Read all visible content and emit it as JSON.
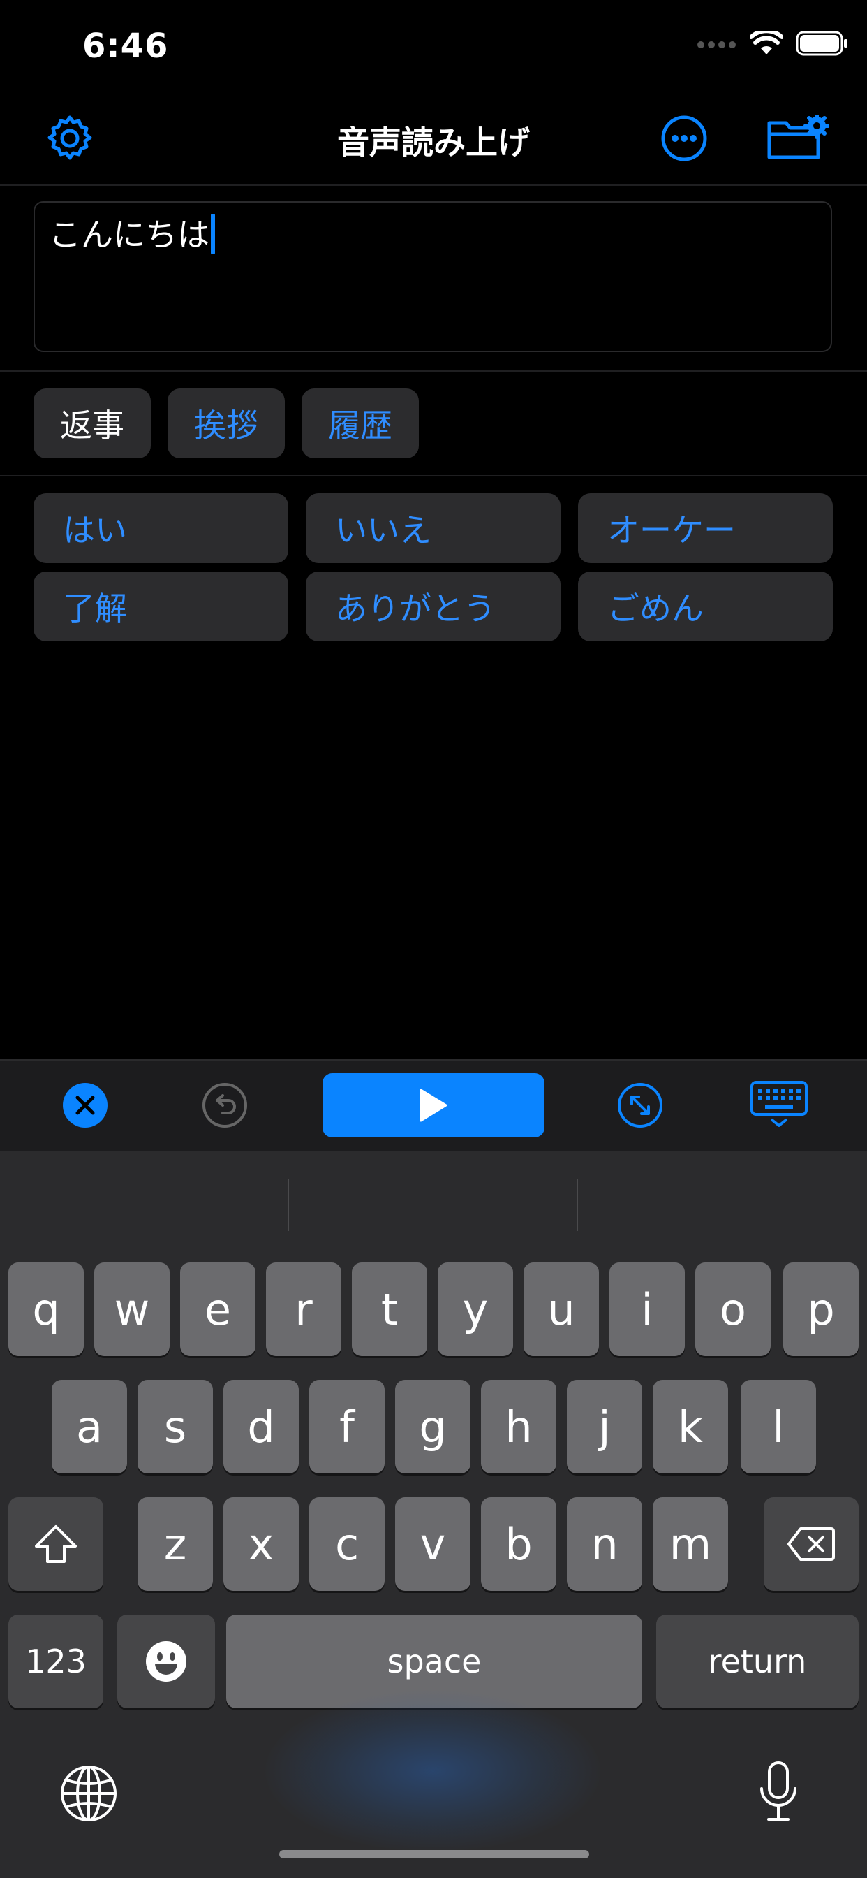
{
  "status_bar": {
    "time": "6:46"
  },
  "nav": {
    "title": "音声読み上げ"
  },
  "editor": {
    "text": "こんにちは"
  },
  "categories": [
    {
      "label": "返事"
    },
    {
      "label": "挨拶"
    },
    {
      "label": "履歴"
    }
  ],
  "phrases": [
    {
      "label": "はい"
    },
    {
      "label": "いいえ"
    },
    {
      "label": "オーケー"
    },
    {
      "label": "了解"
    },
    {
      "label": "ありがとう"
    },
    {
      "label": "ごめん"
    }
  ],
  "keyboard": {
    "row1": [
      "q",
      "w",
      "e",
      "r",
      "t",
      "y",
      "u",
      "i",
      "o",
      "p"
    ],
    "row2": [
      "a",
      "s",
      "d",
      "f",
      "g",
      "h",
      "j",
      "k",
      "l"
    ],
    "row3": [
      "z",
      "x",
      "c",
      "v",
      "b",
      "n",
      "m"
    ],
    "numbers_label": "123",
    "space_label": "space",
    "return_label": "return"
  },
  "colors": {
    "accent": "#0a84ff",
    "phrase_text": "#2f8dff",
    "button_bg": "#2c2c2e"
  }
}
